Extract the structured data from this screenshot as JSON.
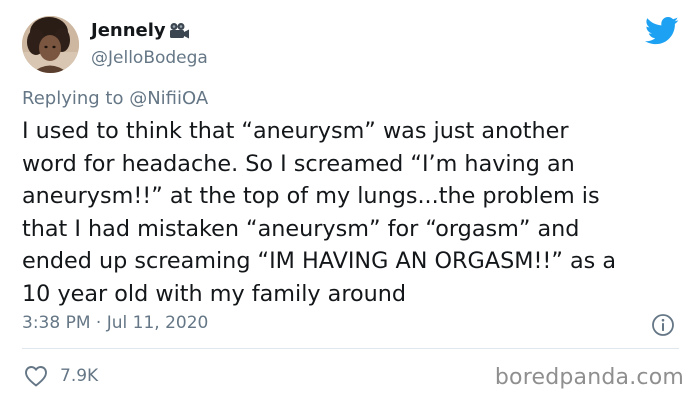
{
  "author": {
    "display_name": "Jennely",
    "name_emoji": "movie-camera-icon",
    "handle": "@JelloBodega"
  },
  "reply": {
    "prefix": "Replying to",
    "mention": "@NifiiOA"
  },
  "tweet": {
    "lines": [
      "I used to think that “aneurysm” was just another",
      "word for headache. So I screamed “I’m having an",
      "aneurysm!!” at the top of my lungs...the problem is",
      "that I had mistaken “aneurysm” for “orgasm” and",
      "ended up screaming “IM HAVING AN ORGASM!!” as a",
      "10 year old with my family around"
    ]
  },
  "meta": {
    "timestamp": "3:38 PM · Jul 11, 2020",
    "likes": "7.9K"
  },
  "watermark": "boredpanda.com",
  "colors": {
    "twitter_blue": "#1da1f2",
    "text": "#14171a",
    "secondary": "#657786",
    "divider": "#e1e8ed",
    "watermark": "#8f8f8f"
  },
  "icons": [
    "avatar",
    "movie-camera-icon",
    "twitter-bird-icon",
    "info-icon",
    "heart-icon"
  ]
}
